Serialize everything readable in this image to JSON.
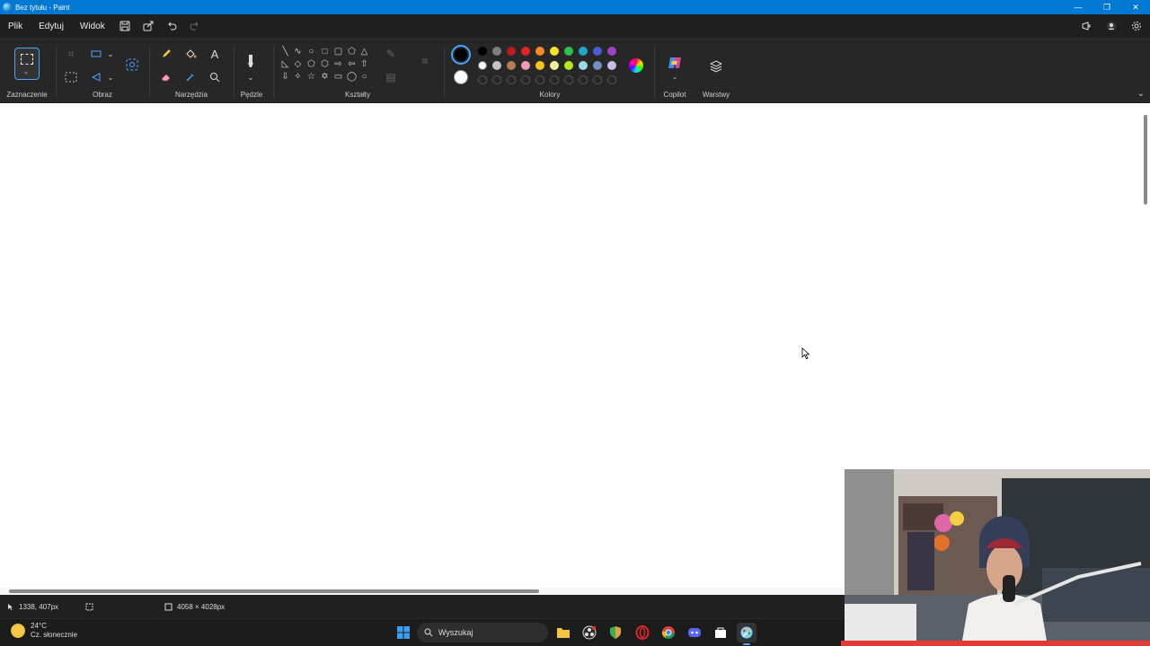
{
  "titlebar": {
    "title": "Bez tytułu - Paint",
    "minimize": "—",
    "restore": "❐",
    "close": "✕"
  },
  "menubar": {
    "items": [
      "Plik",
      "Edytuj",
      "Widok"
    ]
  },
  "ribbon": {
    "groups": [
      "Zaznaczenie",
      "Obraz",
      "Narzędzia",
      "Pędzle",
      "Kształty",
      "Kolory",
      "Copilot",
      "Warstwy"
    ],
    "colors_row1": [
      "#000000",
      "#7f7f7f",
      "#b81c1c",
      "#e02424",
      "#f28c28",
      "#f5e02c",
      "#2fbf4a",
      "#1fa7c9",
      "#4a5bd4",
      "#a040c8"
    ],
    "colors_row2": [
      "#ffffff",
      "#c3c3c3",
      "#b77a57",
      "#f39ab6",
      "#f6c21d",
      "#f3ee9a",
      "#b5e61d",
      "#99d9ea",
      "#7092be",
      "#c8bfe7"
    ],
    "primary_color": "#000000",
    "secondary_color": "#ffffff",
    "accent": "#0078d4"
  },
  "statusbar": {
    "cursor_position": "1338, 407px",
    "canvas_size": "4058 × 4028px"
  },
  "taskbar": {
    "weather_temp": "24°C",
    "weather_desc": "Cz. słonecznie",
    "search_placeholder": "Wyszukaj"
  }
}
